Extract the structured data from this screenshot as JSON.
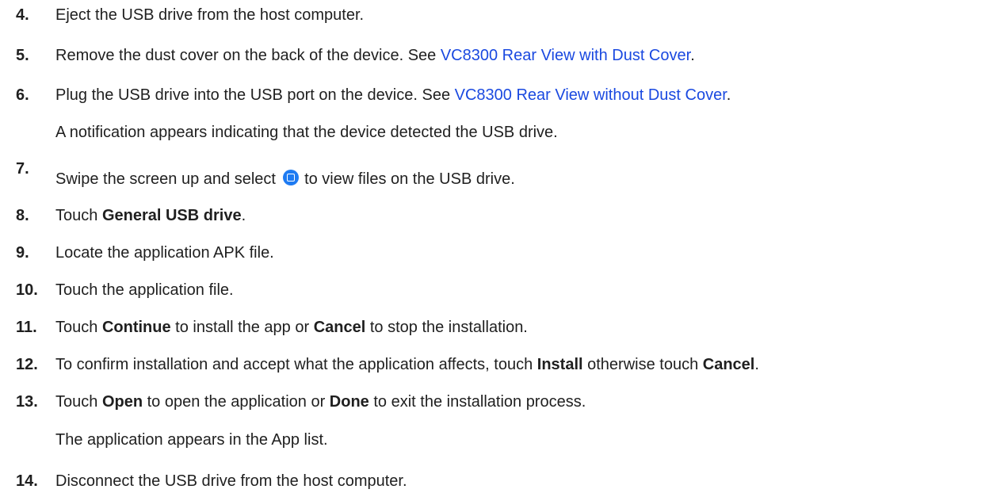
{
  "steps": [
    {
      "num": "4.",
      "text": "Eject the USB drive from the host computer."
    },
    {
      "num": "5.",
      "text_before": "Remove the dust cover on the back of the device. See ",
      "link": "VC8300 Rear View with Dust Cover",
      "text_after": "."
    },
    {
      "num": "6.",
      "text_before": "Plug the USB drive into the USB port on the device. See ",
      "link": "VC8300 Rear View without Dust Cover",
      "text_after": ".",
      "note": "A notification appears indicating that the device detected the USB drive."
    },
    {
      "num": "7.",
      "text_before": "Swipe the screen up and select ",
      "icon": "files-app-icon",
      "text_after": " to view files on the USB drive."
    },
    {
      "num": "8.",
      "text_before": "Touch ",
      "bold": "General USB drive",
      "text_after": "."
    },
    {
      "num": "9.",
      "text": "Locate the application APK file."
    },
    {
      "num": "10.",
      "text": "Touch the application file."
    },
    {
      "num": "11.",
      "text_before": "Touch ",
      "bold1": "Continue",
      "text_mid": " to install the app or ",
      "bold2": "Cancel",
      "text_after": " to stop the installation."
    },
    {
      "num": "12.",
      "text_before": "To confirm installation and accept what the application affects, touch ",
      "bold1": "Install",
      "text_mid": " otherwise touch ",
      "bold2": "Cancel",
      "text_after": "."
    },
    {
      "num": "13.",
      "text_before": "Touch ",
      "bold1": "Open",
      "text_mid": " to open the application or ",
      "bold2": "Done",
      "text_after": " to exit the installation process.",
      "note": "The application appears in the App list."
    },
    {
      "num": "14.",
      "text": "Disconnect the USB drive from the host computer."
    }
  ],
  "colors": {
    "link": "#1a49e0",
    "icon": "#1e7bf2",
    "text": "#1f1f1f"
  }
}
